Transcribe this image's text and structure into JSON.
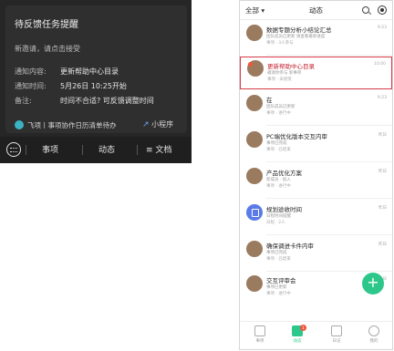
{
  "left": {
    "card_title": "待反馈任务提醒",
    "card_subtitle": "新邀请，请点击接受",
    "rows": [
      {
        "label": "通知内容:",
        "value": "更新帮助中心目录"
      },
      {
        "label": "通知时间:",
        "value": "5月26日 10:25开始"
      },
      {
        "label": "备注:",
        "value": "时间不合适? 可反馈调整时间"
      }
    ],
    "source": "飞项丨事项协作日历清单待办",
    "mini_program": "小程序",
    "bottom_tabs": [
      "事项",
      "动态",
      "文档"
    ]
  },
  "phone": {
    "filter": "全部",
    "title": "动态",
    "items": [
      {
        "title": "数据专题分析小结论汇总",
        "desc": "团队成员已更新 请查看最新进度",
        "meta": "事项 · 3人参与",
        "time": "9:23"
      },
      {
        "title": "更新帮助中心目录",
        "desc": "邀请你参与 新事项",
        "meta": "事项 · 未接受",
        "time": "10:00"
      },
      {
        "title": "在",
        "desc": "团队成员已更新",
        "meta": "事项 · 进行中",
        "time": "9:23"
      },
      {
        "title": "PC端优化版本交互内审",
        "desc": "事项已完成",
        "meta": "事项 · 已结束",
        "time": "昨日"
      },
      {
        "title": "产品优化方案",
        "desc": "新成员 · 加入",
        "meta": "事项 · 进行中",
        "time": "昨日"
      },
      {
        "title": "规划途收时间",
        "desc": "日程时间提醒",
        "meta": "日程 · 2人",
        "time": "昨日"
      },
      {
        "title": "确保调进卡件内审",
        "desc": "事项已完成",
        "meta": "事项 · 已结束",
        "time": "昨日"
      },
      {
        "title": "交互评审会",
        "desc": "事项已更新",
        "meta": "事项 · 进行中",
        "time": "昨日"
      }
    ],
    "fab": "+",
    "nav": [
      "事项",
      "动态",
      "日记",
      "我的"
    ],
    "nav_badge": "1"
  }
}
